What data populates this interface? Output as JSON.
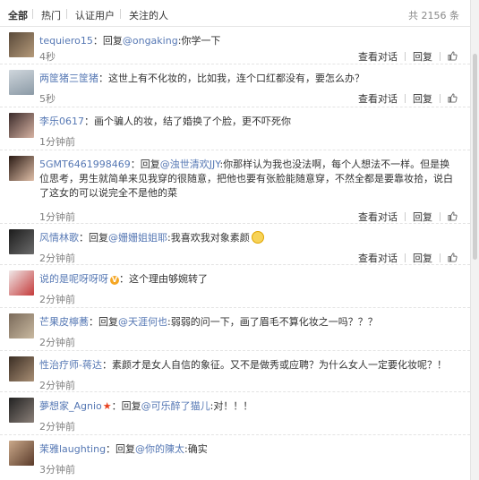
{
  "filter_bar": {
    "tabs": [
      "全部",
      "热门",
      "认证用户",
      "关注的人"
    ],
    "count": "共 2156 条"
  },
  "actions": {
    "view_dialog": "查看对话",
    "reply": "回复"
  },
  "comments": [
    {
      "user": "tequiero15",
      "text": "：回复",
      "mention": "@ongaking",
      "text2": ":你学一下",
      "time": "4秒"
    },
    {
      "user": "两筐猪三筐猪",
      "text": "：这世上有不化妆的，比如我，连个口红都没有，要怎么办？",
      "time": "5秒"
    },
    {
      "user": "李乐0617",
      "text": "：画个骗人的妆，结了婚换了个脸，更不吓死你",
      "time": "1分钟前"
    },
    {
      "user": "5GMT6461998469",
      "text": "：回复",
      "mention": "@浊世清欢JJY",
      "text2": ":你那样认为我也没法啊，每个人想法不一样。但是换位思考，男生就简单来见我穿的很随意，把他也要有张脸能随意穿，不然全都是要靠妆拾，说白了这女的可以说完全不是他的菜",
      "time": "1分钟前"
    },
    {
      "user": "风情林歌",
      "text": "：回复",
      "mention": "@姗姗姐姐耶",
      "text2": ":我喜欢我对象素颜",
      "time": "2分钟前"
    },
    {
      "user": "说的是呢呀呀呀",
      "text": "：这个理由够婉转了",
      "time": "2分钟前"
    },
    {
      "user": "芒果皮檸蕎",
      "text": "：回复",
      "mention": "@天涯何也",
      "text2": ":弱弱的问一下，画了眉毛不算化妆之一吗？？？",
      "time": "2分钟前"
    },
    {
      "user": "性治疗师-蒋达",
      "text": "：素颜才是女人自信的象征。又不是做秀或应聘？为什么女人一定要化妆呢？！",
      "time": "2分钟前"
    },
    {
      "user": "夢想家_Agnio",
      "text": "：回复",
      "mention": "@可乐醉了猫儿",
      "text2": ":对！！！",
      "time": "2分钟前"
    },
    {
      "user": "茉雅laughting",
      "text": "：回复",
      "mention": "@你的陳太",
      "text2": ":确实",
      "time": "3分钟前"
    }
  ],
  "colors": {
    "link": "#5678b4",
    "muted": "#808080",
    "text": "#333333"
  }
}
